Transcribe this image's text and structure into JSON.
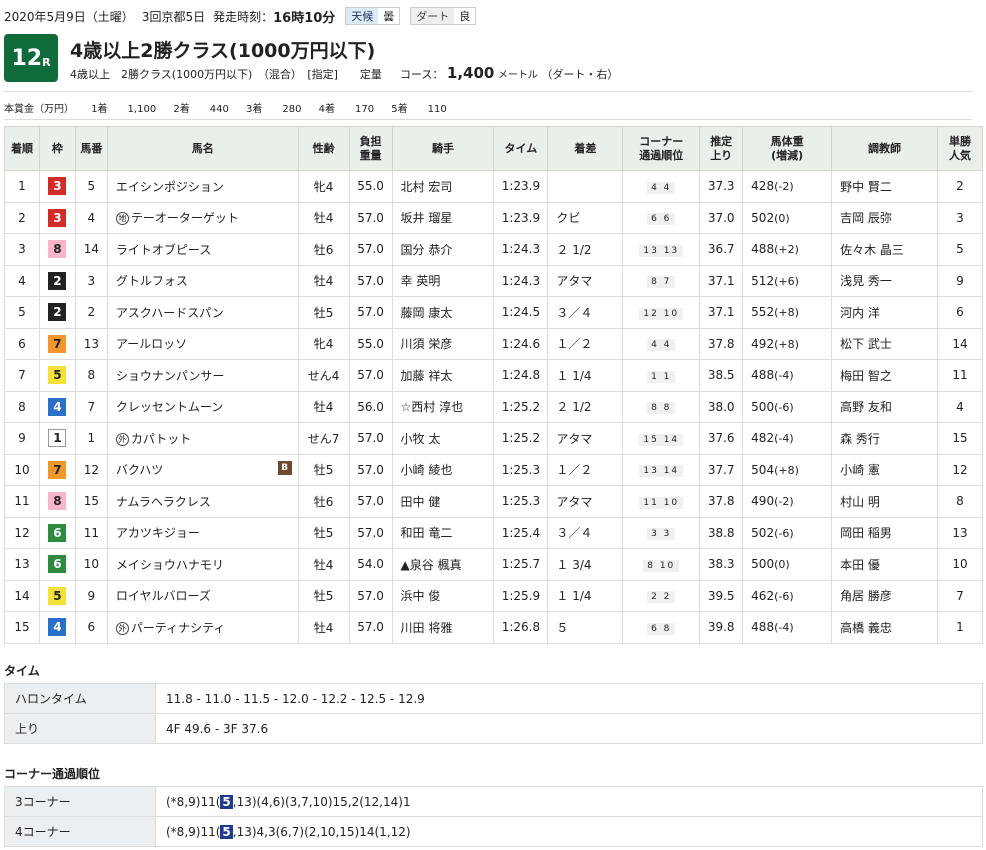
{
  "header": {
    "date": "2020年5月9日（土曜）",
    "meeting": "3回京都5日",
    "start_label": "発走時刻：",
    "start_time": "16時10分",
    "weather_label": "天候",
    "weather_value": "曇",
    "track_label": "ダート",
    "track_value": "良"
  },
  "race": {
    "number": "12",
    "r_suffix": "R",
    "title": "4歳以上2勝クラス(1000万円以下)",
    "conditions": "4歳以上　2勝クラス(1000万円以下)　（混合）　[指定]　　定量",
    "course_label": "コース：",
    "distance": "1,400",
    "meter": "メートル",
    "course_detail": "（ダート・右）"
  },
  "prize": {
    "label": "本賞金（万円）",
    "items": [
      "1着　　1,100",
      "2着　　440",
      "3着　　280",
      "4着　　170",
      "5着　　110"
    ]
  },
  "columns": [
    "着順",
    "枠",
    "馬番",
    "馬名",
    "性齢",
    "負担\n重量",
    "騎手",
    "タイム",
    "着差",
    "コーナー\n通過順位",
    "推定\n上り",
    "馬体重\n(増減)",
    "調教師",
    "単勝\n人気"
  ],
  "rows": [
    {
      "rank": "1",
      "waku": "3",
      "num": "5",
      "mark": "",
      "name": "エイシンポジション",
      "blink": "",
      "sex": "牝4",
      "wt": "55.0",
      "jockey": "北村 宏司",
      "time": "1:23.9",
      "margin": "",
      "corner": "4 4",
      "up": "37.3",
      "body": "428",
      "diff": "(-2)",
      "trainer": "野中 賢二",
      "pop": "2"
    },
    {
      "rank": "2",
      "waku": "3",
      "num": "4",
      "mark": "地",
      "name": "テーオーターゲット",
      "blink": "",
      "sex": "牡4",
      "wt": "57.0",
      "jockey": "坂井 瑠星",
      "time": "1:23.9",
      "margin": "クビ",
      "corner": "6 6",
      "up": "37.0",
      "body": "502",
      "diff": "(0)",
      "trainer": "吉岡 辰弥",
      "pop": "3"
    },
    {
      "rank": "3",
      "waku": "8",
      "num": "14",
      "mark": "",
      "name": "ライトオブピース",
      "blink": "",
      "sex": "牡6",
      "wt": "57.0",
      "jockey": "国分 恭介",
      "time": "1:24.3",
      "margin": "２ 1/2",
      "corner": "13 13",
      "up": "36.7",
      "body": "488",
      "diff": "(+2)",
      "trainer": "佐々木 晶三",
      "pop": "5"
    },
    {
      "rank": "4",
      "waku": "2",
      "num": "3",
      "mark": "",
      "name": "グトルフォス",
      "blink": "",
      "sex": "牡4",
      "wt": "57.0",
      "jockey": "幸 英明",
      "time": "1:24.3",
      "margin": "アタマ",
      "corner": "8 7",
      "up": "37.1",
      "body": "512",
      "diff": "(+6)",
      "trainer": "浅見 秀一",
      "pop": "9"
    },
    {
      "rank": "5",
      "waku": "2",
      "num": "2",
      "mark": "",
      "name": "アスクハードスパン",
      "blink": "",
      "sex": "牡5",
      "wt": "57.0",
      "jockey": "藤岡 康太",
      "time": "1:24.5",
      "margin": "３／４",
      "corner": "12 10",
      "up": "37.1",
      "body": "552",
      "diff": "(+8)",
      "trainer": "河内 洋",
      "pop": "6"
    },
    {
      "rank": "6",
      "waku": "7",
      "num": "13",
      "mark": "",
      "name": "アールロッソ",
      "blink": "",
      "sex": "牝4",
      "wt": "55.0",
      "jockey": "川須 栄彦",
      "time": "1:24.6",
      "margin": "１／２",
      "corner": "4 4",
      "up": "37.8",
      "body": "492",
      "diff": "(+8)",
      "trainer": "松下 武士",
      "pop": "14"
    },
    {
      "rank": "7",
      "waku": "5",
      "num": "8",
      "mark": "",
      "name": "ショウナンパンサー",
      "blink": "",
      "sex": "せん4",
      "wt": "57.0",
      "jockey": "加藤 祥太",
      "time": "1:24.8",
      "margin": "１ 1/4",
      "corner": "1 1",
      "up": "38.5",
      "body": "488",
      "diff": "(-4)",
      "trainer": "梅田 智之",
      "pop": "11"
    },
    {
      "rank": "8",
      "waku": "4",
      "num": "7",
      "mark": "",
      "name": "クレッセントムーン",
      "blink": "",
      "sex": "牡4",
      "wt": "56.0",
      "jockey": "☆西村 淳也",
      "time": "1:25.2",
      "margin": "２ 1/2",
      "corner": "8 8",
      "up": "38.0",
      "body": "500",
      "diff": "(-6)",
      "trainer": "高野 友和",
      "pop": "4"
    },
    {
      "rank": "9",
      "waku": "1",
      "num": "1",
      "mark": "外",
      "name": "カパトット",
      "blink": "",
      "sex": "せん7",
      "wt": "57.0",
      "jockey": "小牧 太",
      "time": "1:25.2",
      "margin": "アタマ",
      "corner": "15 14",
      "up": "37.6",
      "body": "482",
      "diff": "(-4)",
      "trainer": "森 秀行",
      "pop": "15"
    },
    {
      "rank": "10",
      "waku": "7",
      "num": "12",
      "mark": "",
      "name": "バクハツ",
      "blink": "B",
      "sex": "牡5",
      "wt": "57.0",
      "jockey": "小崎 綾也",
      "time": "1:25.3",
      "margin": "１／２",
      "corner": "13 14",
      "up": "37.7",
      "body": "504",
      "diff": "(+8)",
      "trainer": "小崎 憲",
      "pop": "12"
    },
    {
      "rank": "11",
      "waku": "8",
      "num": "15",
      "mark": "",
      "name": "ナムラヘラクレス",
      "blink": "",
      "sex": "牡6",
      "wt": "57.0",
      "jockey": "田中 健",
      "time": "1:25.3",
      "margin": "アタマ",
      "corner": "11 10",
      "up": "37.8",
      "body": "490",
      "diff": "(-2)",
      "trainer": "村山 明",
      "pop": "8"
    },
    {
      "rank": "12",
      "waku": "6",
      "num": "11",
      "mark": "",
      "name": "アカツキジョー",
      "blink": "",
      "sex": "牡5",
      "wt": "57.0",
      "jockey": "和田 竜二",
      "time": "1:25.4",
      "margin": "３／４",
      "corner": "3 3",
      "up": "38.8",
      "body": "502",
      "diff": "(-6)",
      "trainer": "岡田 稲男",
      "pop": "13"
    },
    {
      "rank": "13",
      "waku": "6",
      "num": "10",
      "mark": "",
      "name": "メイショウハナモリ",
      "blink": "",
      "sex": "牡4",
      "wt": "54.0",
      "jockey": "▲泉谷 楓真",
      "time": "1:25.7",
      "margin": "１ 3/4",
      "corner": "8 10",
      "up": "38.3",
      "body": "500",
      "diff": "(0)",
      "trainer": "本田 優",
      "pop": "10"
    },
    {
      "rank": "14",
      "waku": "5",
      "num": "9",
      "mark": "",
      "name": "ロイヤルバローズ",
      "blink": "",
      "sex": "牡5",
      "wt": "57.0",
      "jockey": "浜中 俊",
      "time": "1:25.9",
      "margin": "１ 1/4",
      "corner": "2 2",
      "up": "39.5",
      "body": "462",
      "diff": "(-6)",
      "trainer": "角居 勝彦",
      "pop": "7"
    },
    {
      "rank": "15",
      "waku": "4",
      "num": "6",
      "mark": "外",
      "name": "パーティナシティ",
      "blink": "",
      "sex": "牡4",
      "wt": "57.0",
      "jockey": "川田 将雅",
      "time": "1:26.8",
      "margin": "５",
      "corner": "6 8",
      "up": "39.8",
      "body": "488",
      "diff": "(-4)",
      "trainer": "高橋 義忠",
      "pop": "1"
    }
  ],
  "time_section": {
    "title": "タイム",
    "halon_label": "ハロンタイム",
    "halon_value": "11.8 - 11.0 - 11.5 - 12.0 - 12.2 - 12.5 - 12.9",
    "agari_label": "上り",
    "agari_value": "4F 49.6 - 3F 37.6"
  },
  "corner_section": {
    "title": "コーナー通過順位",
    "c3_label": "3コーナー",
    "c3_pre": "(*8,9)11(",
    "c3_hl": "5",
    "c3_post": ",13)(4,6)(3,7,10)15,2(12,14)1",
    "c4_label": "4コーナー",
    "c4_pre": "(*8,9)11(",
    "c4_hl": "5",
    "c4_post": ",13)4,3(6,7)(2,10,15)14(1,12)"
  }
}
